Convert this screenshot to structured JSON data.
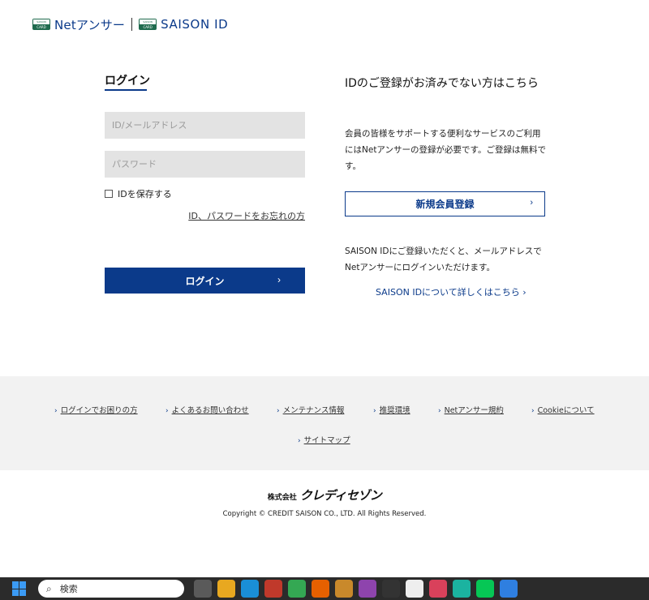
{
  "header": {
    "card_top": "SAISON",
    "card_bottom": "CARD",
    "brand1": "Netアンサー",
    "brand2": "SAISON ID"
  },
  "login": {
    "title": "ログイン",
    "id_placeholder": "ID/メールアドレス",
    "password_placeholder": "パスワード",
    "remember_label": "IDを保存する",
    "forgot_link": "ID、パスワードをお忘れの方",
    "button_label": "ログイン",
    "chevron": "›"
  },
  "register": {
    "title": "IDのご登録がお済みでない方はこちら",
    "description": "会員の皆様をサポートする便利なサービスのご利用にはNetアンサーの登録が必要です。ご登録は無料です。",
    "button_label": "新規会員登録",
    "chevron": "›",
    "saison_text": "SAISON IDにご登録いただくと、メールアドレスでNetアンサーにログインいただけます。",
    "saison_link": "SAISON IDについて詳しくはこちら ›"
  },
  "footer_links": [
    {
      "label": "ログインでお困りの方"
    },
    {
      "label": "よくあるお問い合わせ"
    },
    {
      "label": "メンテナンス情報"
    },
    {
      "label": "推奨環境"
    },
    {
      "label": "Netアンサー規約"
    },
    {
      "label": "Cookieについて"
    },
    {
      "label": "サイトマップ"
    }
  ],
  "link_arrow": "›",
  "company": {
    "prefix": "株式会社",
    "name": "クレディセゾン",
    "copyright": "Copyright © CREDIT SAISON CO., LTD. All Rights Reserved."
  },
  "taskbar": {
    "search_placeholder": "検索",
    "search_icon": "magnifier-icon",
    "apps": [
      {
        "name": "task-view-icon",
        "color": "#5a5a5a"
      },
      {
        "name": "file-explorer-icon",
        "color": "#e8a820"
      },
      {
        "name": "edge-icon",
        "color": "#1a8fd6"
      },
      {
        "name": "app-icon",
        "color": "#c0392b"
      },
      {
        "name": "chrome-icon",
        "color": "#34a853"
      },
      {
        "name": "firefox-icon",
        "color": "#e66000"
      },
      {
        "name": "app-icon-2",
        "color": "#c9892b"
      },
      {
        "name": "app-icon-3",
        "color": "#8e44ad"
      },
      {
        "name": "app-icon-4",
        "color": "#333333"
      },
      {
        "name": "notepad-icon",
        "color": "#eeeeee"
      },
      {
        "name": "music-icon",
        "color": "#d9415b"
      },
      {
        "name": "app-icon-5",
        "color": "#1bb3a0"
      },
      {
        "name": "line-icon",
        "color": "#06c755"
      },
      {
        "name": "app-icon-6",
        "color": "#2f7fe0"
      }
    ]
  }
}
